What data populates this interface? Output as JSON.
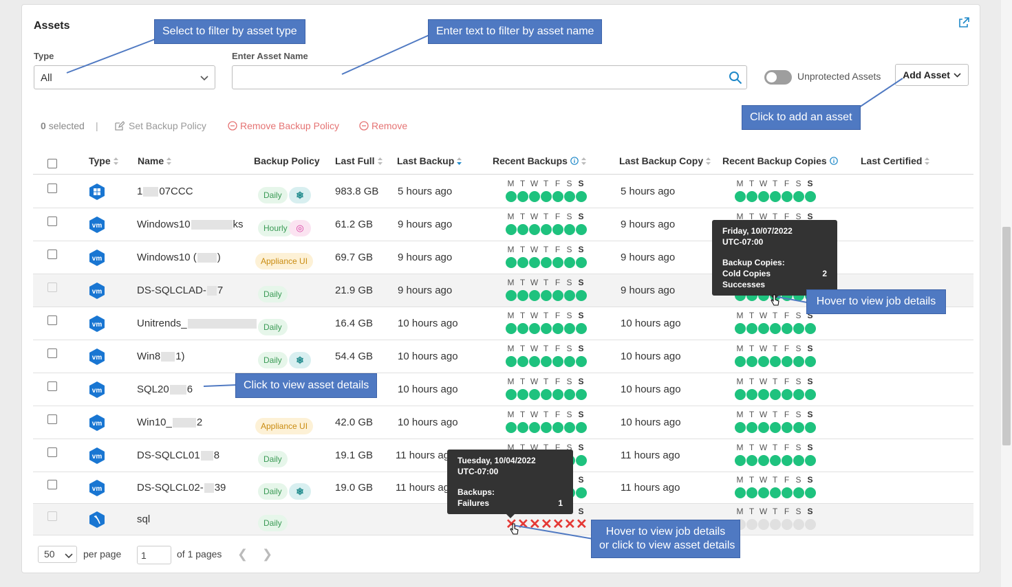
{
  "panel": {
    "title": "Assets"
  },
  "filters": {
    "type_label": "Type",
    "type_value": "All",
    "name_label": "Enter Asset Name",
    "name_placeholder": "",
    "unprotected_label": "Unprotected Assets",
    "add_asset_label": "Add Asset"
  },
  "toolbar": {
    "selected_count": "0",
    "selected_text": "selected",
    "separator": "|",
    "set_policy": "Set Backup Policy",
    "remove_policy": "Remove Backup Policy",
    "remove": "Remove"
  },
  "columns": {
    "type": "Type",
    "name": "Name",
    "policy": "Backup Policy",
    "last_full": "Last Full",
    "last_backup": "Last Backup",
    "recent_backups": "Recent Backups",
    "last_copy": "Last Backup Copy",
    "recent_copies": "Recent Backup Copies",
    "last_certified": "Last Certified"
  },
  "days": [
    "M",
    "T",
    "W",
    "T",
    "F",
    "S",
    "S"
  ],
  "rows": [
    {
      "icon": "windows-icon",
      "name_a": "1",
      "name_b": "07CCC",
      "policy": "Daily",
      "policy_style": "green",
      "extra": "snow",
      "last_full": "983.8 GB",
      "last_backup": "5 hours ago",
      "backups": "ok",
      "last_copy": "5 hours ago",
      "copies": "ok"
    },
    {
      "icon": "vm-icon",
      "name_a": "Windows10",
      "name_b": "ks",
      "policy": "Hourly",
      "policy_style": "green",
      "extra": "fire",
      "last_full": "61.2 GB",
      "last_backup": "9 hours ago",
      "backups": "ok",
      "last_copy": "9 hours ago",
      "copies": "ok"
    },
    {
      "icon": "vm-icon",
      "name_a": "Windows10 (",
      "name_b": ")",
      "policy": "Appliance UI",
      "policy_style": "amber",
      "extra": "",
      "last_full": "69.7 GB",
      "last_backup": "9 hours ago",
      "backups": "ok",
      "last_copy": "9 hours ago",
      "copies": "ok"
    },
    {
      "icon": "vm-icon",
      "name_a": "DS-SQLCLAD-",
      "name_b": "7",
      "policy": "Daily",
      "policy_style": "green",
      "extra": "",
      "last_full": "21.9 GB",
      "last_backup": "9 hours ago",
      "backups": "ok",
      "last_copy": "9 hours ago",
      "copies": "ok"
    },
    {
      "icon": "vm-icon",
      "name_a": "Unitrends_",
      "name_b": "",
      "policy": "Daily",
      "policy_style": "green",
      "extra": "",
      "last_full": "16.4 GB",
      "last_backup": "10 hours ago",
      "backups": "ok",
      "last_copy": "10 hours ago",
      "copies": "ok"
    },
    {
      "icon": "vm-icon",
      "name_a": "Win8",
      "name_b": "1)",
      "policy": "Daily",
      "policy_style": "green",
      "extra": "snow",
      "last_full": "54.4 GB",
      "last_backup": "10 hours ago",
      "backups": "ok",
      "last_copy": "10 hours ago",
      "copies": "ok"
    },
    {
      "icon": "vm-icon",
      "name_a": "SQL20",
      "name_b": "6",
      "policy": "",
      "policy_style": "",
      "extra": "",
      "last_full": "",
      "last_backup": "10 hours ago",
      "backups": "ok",
      "last_copy": "10 hours ago",
      "copies": "ok"
    },
    {
      "icon": "vm-icon",
      "name_a": "Win10_",
      "name_b": "2",
      "policy": "Appliance UI",
      "policy_style": "amber",
      "extra": "",
      "last_full": "42.0 GB",
      "last_backup": "10 hours ago",
      "backups": "ok",
      "last_copy": "10 hours ago",
      "copies": "ok"
    },
    {
      "icon": "vm-icon",
      "name_a": "DS-SQLCL01",
      "name_b": "8",
      "policy": "Daily",
      "policy_style": "green",
      "extra": "",
      "last_full": "19.1 GB",
      "last_backup": "11 hours ag",
      "backups": "ok",
      "last_copy": "11 hours ago",
      "copies": "ok"
    },
    {
      "icon": "vm-icon",
      "name_a": "DS-SQLCL02-",
      "name_b": "39",
      "policy": "Daily",
      "policy_style": "green",
      "extra": "snow",
      "last_full": "19.0 GB",
      "last_backup": "11 hours ag",
      "backups": "ok",
      "last_copy": "11 hours ago",
      "copies": "ok"
    },
    {
      "icon": "sql-icon",
      "name_a": "sql",
      "name_b": "",
      "policy": "Daily",
      "policy_style": "green",
      "extra": "",
      "last_full": "",
      "last_backup": "",
      "backups": "fail",
      "last_copy": "",
      "copies": "empty"
    }
  ],
  "pager": {
    "page_size": "50",
    "per_page": "per page",
    "page": "1",
    "of_pages": "of 1 pages"
  },
  "tooltip_copies": {
    "date": "Friday, 10/07/2022",
    "tz": "UTC-07:00",
    "heading": "Backup Copies:",
    "key": "Cold Copies Successes",
    "value": "2"
  },
  "tooltip_backups": {
    "date": "Tuesday, 10/04/2022",
    "tz": "UTC-07:00",
    "heading": "Backups:",
    "key": "Failures",
    "value": "1"
  },
  "callouts": {
    "filter_type": "Select to filter by asset type",
    "filter_name": "Enter text to filter by asset name",
    "add_asset": "Click to add an asset",
    "hover_job": "Hover to view job details",
    "asset_details": "Click to view asset details",
    "hover_or_click_1": "Hover to view job details",
    "hover_or_click_2": "or click to view asset details"
  },
  "colors": {
    "success": "#1ec27e",
    "failure": "#e53935",
    "callout": "#4f79c2",
    "tooltip": "#333333"
  }
}
